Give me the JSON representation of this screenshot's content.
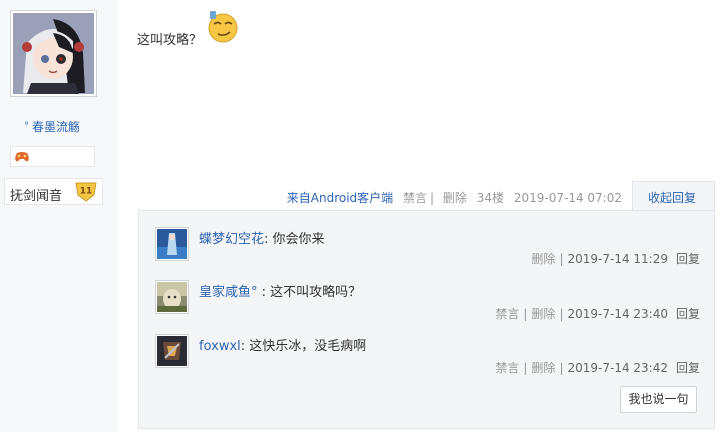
{
  "author": {
    "username": "春墨流觞",
    "username_prefix": "°",
    "level_name": "抚剑闻音",
    "level_number": "11"
  },
  "post": {
    "text": "这叫攻略？",
    "source": "来自Android客户端",
    "ban": "禁言",
    "delete": "删除",
    "floor": "34楼",
    "time": "2019-07-14 07:02",
    "collapse": "收起回复"
  },
  "replies": [
    {
      "user": "蝶梦幻空花",
      "colon": ":",
      "text": " 你会你来",
      "actions": [
        "删除"
      ],
      "time": "2019-7-14 11:29",
      "reply": "回复"
    },
    {
      "user": "皇家咸鱼°",
      "colon": " :",
      "text": " 这不叫攻略吗？",
      "actions": [
        "禁言",
        "删除"
      ],
      "time": "2019-7-14 23:40",
      "reply": "回复"
    },
    {
      "user": "foxwxl",
      "colon": ":",
      "text": " 这快乐冰，没毛病啊",
      "actions": [
        "禁言",
        "删除"
      ],
      "time": "2019-7-14 23:42",
      "reply": "回复"
    }
  ],
  "say_button": "我也说一句",
  "colors": {
    "link": "#2d64b3",
    "meta": "#999999",
    "reply_bg": "#f4f5f7",
    "left_bg": "#f7f8fa",
    "badge": "#f5c644"
  },
  "icons": {
    "emoji": "smug-face-emoji-icon",
    "gamepad": "gamepad-icon",
    "badge": "level-badge-icon"
  }
}
